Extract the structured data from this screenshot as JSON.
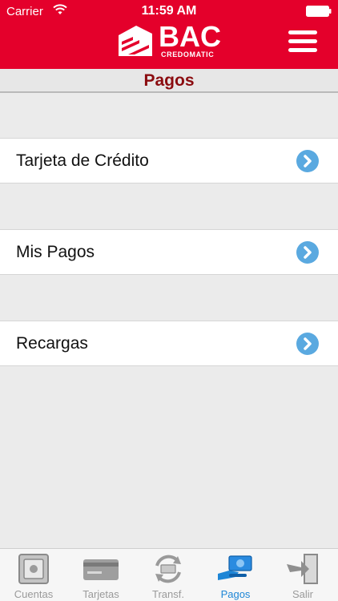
{
  "status": {
    "carrier": "Carrier",
    "time": "11:59 AM"
  },
  "header": {
    "logo_text": "BAC",
    "logo_sub": "CREDOMATIC"
  },
  "page": {
    "title": "Pagos"
  },
  "rows": [
    {
      "label": "Tarjeta de Crédito"
    },
    {
      "label": "Mis Pagos"
    },
    {
      "label": "Recargas"
    }
  ],
  "tabs": [
    {
      "label": "Cuentas",
      "icon": "safe-icon"
    },
    {
      "label": "Tarjetas",
      "icon": "card-icon"
    },
    {
      "label": "Transf.",
      "icon": "transfer-icon"
    },
    {
      "label": "Pagos",
      "icon": "payment-icon",
      "active": true
    },
    {
      "label": "Salir",
      "icon": "exit-icon"
    }
  ],
  "colors": {
    "brand_red": "#e4002b",
    "title_red": "#8b0c10",
    "chevron_blue": "#5aa9e0",
    "active_tab": "#1e86d6"
  }
}
